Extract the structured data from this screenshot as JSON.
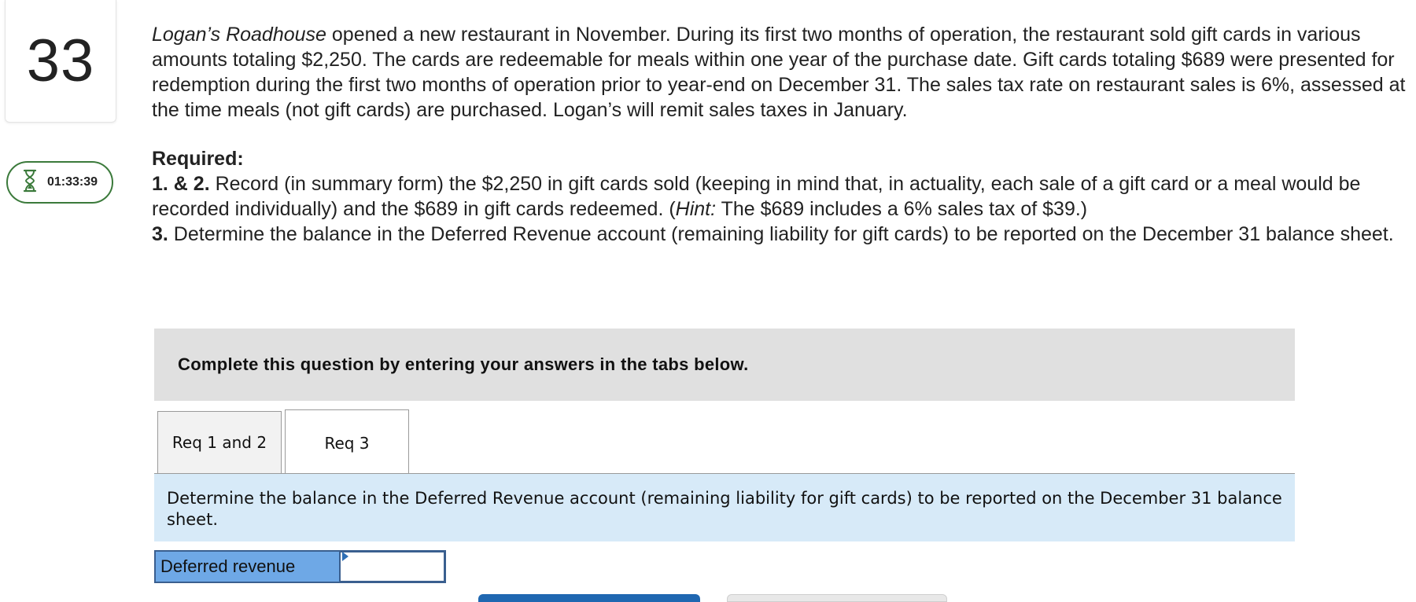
{
  "question": {
    "number": "33",
    "timer": "01:33:39"
  },
  "problem": {
    "company": "Logan’s Roadhouse",
    "text": " opened a new restaurant in November. During its first two months of operation, the restaurant sold gift cards in various amounts totaling $2,250. The cards are redeemable for meals within one year of the purchase date. Gift cards totaling $689 were presented for redemption during the first two months of operation prior to year-end on December 31. The sales tax rate on restaurant sales is 6%, assessed at the time meals (not gift cards) are purchased. Logan’s will remit sales taxes in January."
  },
  "required": {
    "heading": "Required:",
    "item1_label": "1. & 2.",
    "item1_text": " Record (in summary form) the $2,250 in gift cards sold (keeping in mind that, in actuality, each sale of a gift card or a meal would be recorded individually) and the $689 in gift cards redeemed. (",
    "item1_hint_label": "Hint:",
    "item1_hint_text": " The $689 includes a 6% sales tax of $39.)",
    "item3_label": "3.",
    "item3_text": " Determine the balance in the Deferred Revenue account (remaining liability for gift cards) to be reported on the December 31 balance sheet."
  },
  "instructions": "Complete this question by entering your answers in the tabs below.",
  "tabs": [
    {
      "label": "Req 1 and 2",
      "active": false
    },
    {
      "label": "Req 3",
      "active": true
    }
  ],
  "tab_description": "Determine the balance in the Deferred Revenue account (remaining liability for gift cards) to be reported on the December 31 balance sheet.",
  "answer": {
    "label": "Deferred revenue",
    "value": ""
  },
  "colors": {
    "timer_border": "#3b7a3b",
    "answer_label_bg": "#6ea8e6",
    "description_bg": "#d7eaf8",
    "primary_button": "#1f67b1"
  }
}
